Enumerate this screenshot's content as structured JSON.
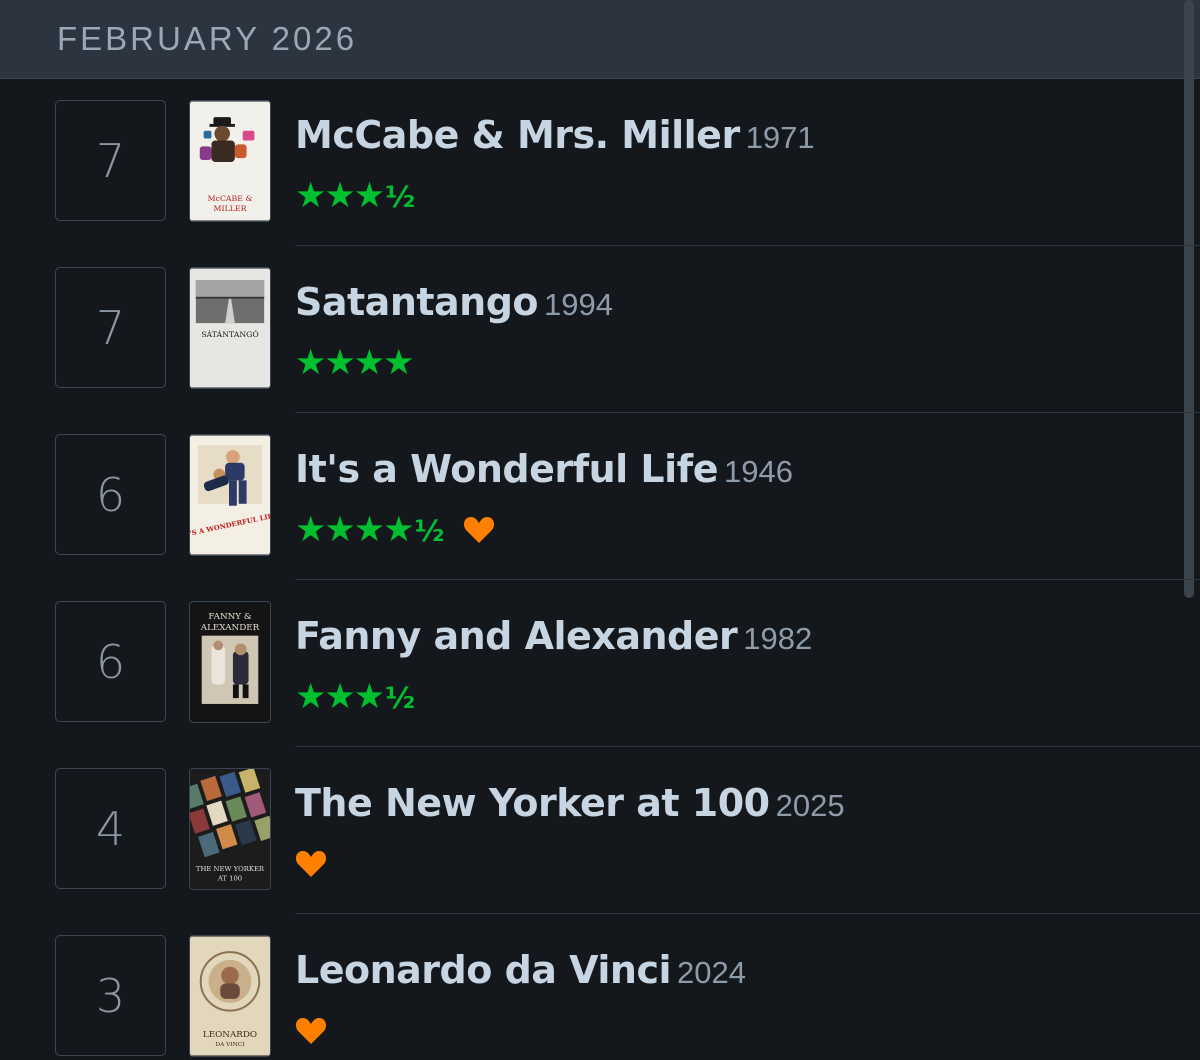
{
  "month": "FEBRUARY 2026",
  "entries": [
    {
      "day": "7",
      "title": "McCabe & Mrs. Miller",
      "year": "1971",
      "stars": "★★★",
      "half": "½",
      "liked": false,
      "poster_icon": "mccabe-poster"
    },
    {
      "day": "7",
      "title": "Satantango",
      "year": "1994",
      "stars": "★★★★",
      "half": "",
      "liked": false,
      "poster_icon": "satantango-poster"
    },
    {
      "day": "6",
      "title": "It's a Wonderful Life",
      "year": "1946",
      "stars": "★★★★",
      "half": "½",
      "liked": true,
      "poster_icon": "wonderful-life-poster"
    },
    {
      "day": "6",
      "title": "Fanny and Alexander",
      "year": "1982",
      "stars": "★★★",
      "half": "½",
      "liked": false,
      "poster_icon": "fanny-alexander-poster"
    },
    {
      "day": "4",
      "title": "The New Yorker at 100",
      "year": "2025",
      "stars": "",
      "half": "",
      "liked": true,
      "poster_icon": "new-yorker-poster"
    },
    {
      "day": "3",
      "title": "Leonardo da Vinci",
      "year": "2024",
      "stars": "",
      "half": "",
      "liked": true,
      "poster_icon": "leonardo-poster"
    }
  ],
  "colors": {
    "background": "#14181c",
    "header": "#2c3440",
    "star": "#00c030",
    "heart": "#ff8000",
    "title": "#c7d4e2"
  }
}
